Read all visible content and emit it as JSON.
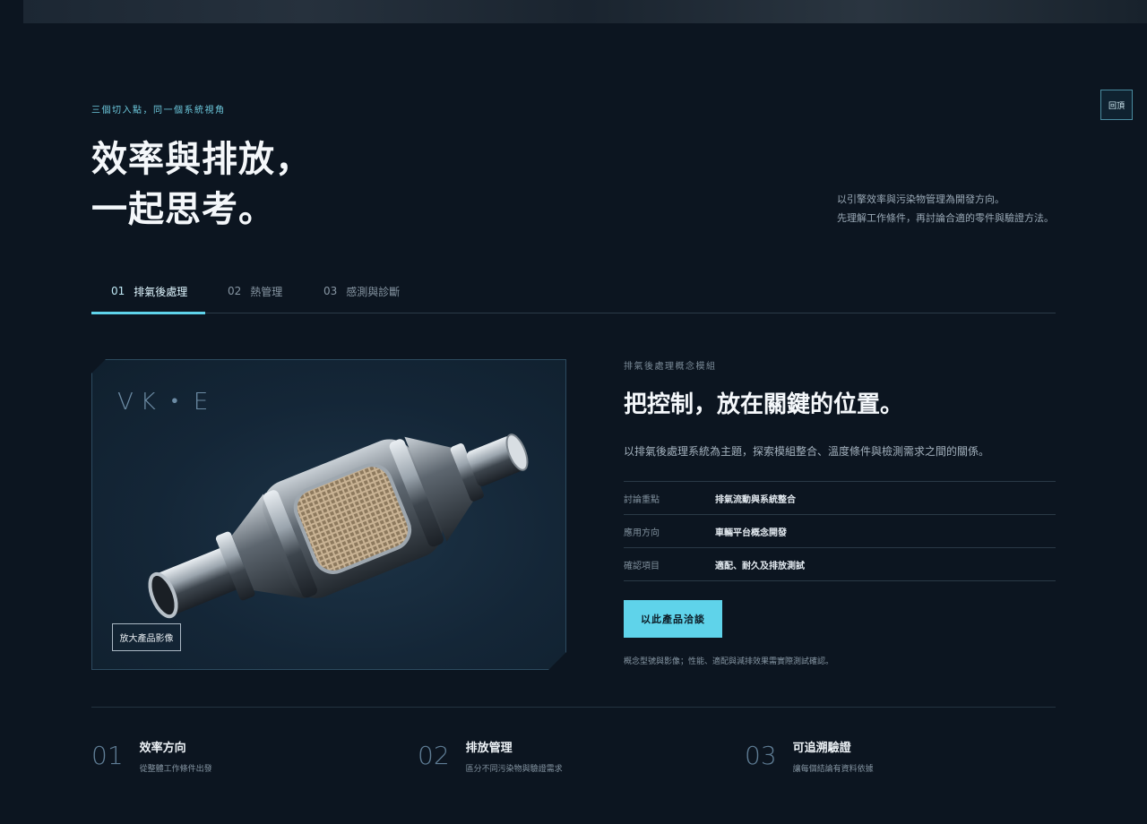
{
  "back_button": {
    "label": "回頂"
  },
  "hero": {
    "eyebrow": "三個切入點，同一個系統視角",
    "title_line1": "效率與排放，",
    "title_line2": "一起思考。",
    "intro_line1": "以引擎效率與污染物管理為開發方向。",
    "intro_line2": "先理解工作條件，再討論合適的零件與驗證方法。"
  },
  "tabs": [
    {
      "num": "01",
      "label": "排氣後處理",
      "active": true
    },
    {
      "num": "02",
      "label": "熱管理",
      "active": false
    },
    {
      "num": "03",
      "label": "感測與診斷",
      "active": false
    }
  ],
  "product": {
    "model_code": "VK・E",
    "zoom_label": "放大產品影像",
    "image_icon": "catalytic-converter-icon"
  },
  "detail": {
    "eyebrow": "排氣後處理概念模組",
    "title": "把控制，放在關鍵的位置。",
    "description": "以排氣後處理系統為主題，探索模組整合、溫度條件與檢測需求之間的關係。",
    "specs": [
      {
        "key": "討論重點",
        "value": "排氣流動與系統整合"
      },
      {
        "key": "應用方向",
        "value": "車輛平台概念開發"
      },
      {
        "key": "確認項目",
        "value": "適配、耐久及排放測試"
      }
    ],
    "cta_label": "以此產品洽談",
    "note": "概念型號與影像；性能、適配與減排效果需實際測試確認。"
  },
  "features": [
    {
      "num": "01",
      "title": "效率方向",
      "subtitle": "從整體工作條件出發"
    },
    {
      "num": "02",
      "title": "排放管理",
      "subtitle": "區分不同污染物與驗證需求"
    },
    {
      "num": "03",
      "title": "可追溯驗證",
      "subtitle": "讓每個結論有資料依據"
    }
  ],
  "colors": {
    "background": "#0c1520",
    "accent": "#5fd3ea",
    "card": "#142637"
  }
}
